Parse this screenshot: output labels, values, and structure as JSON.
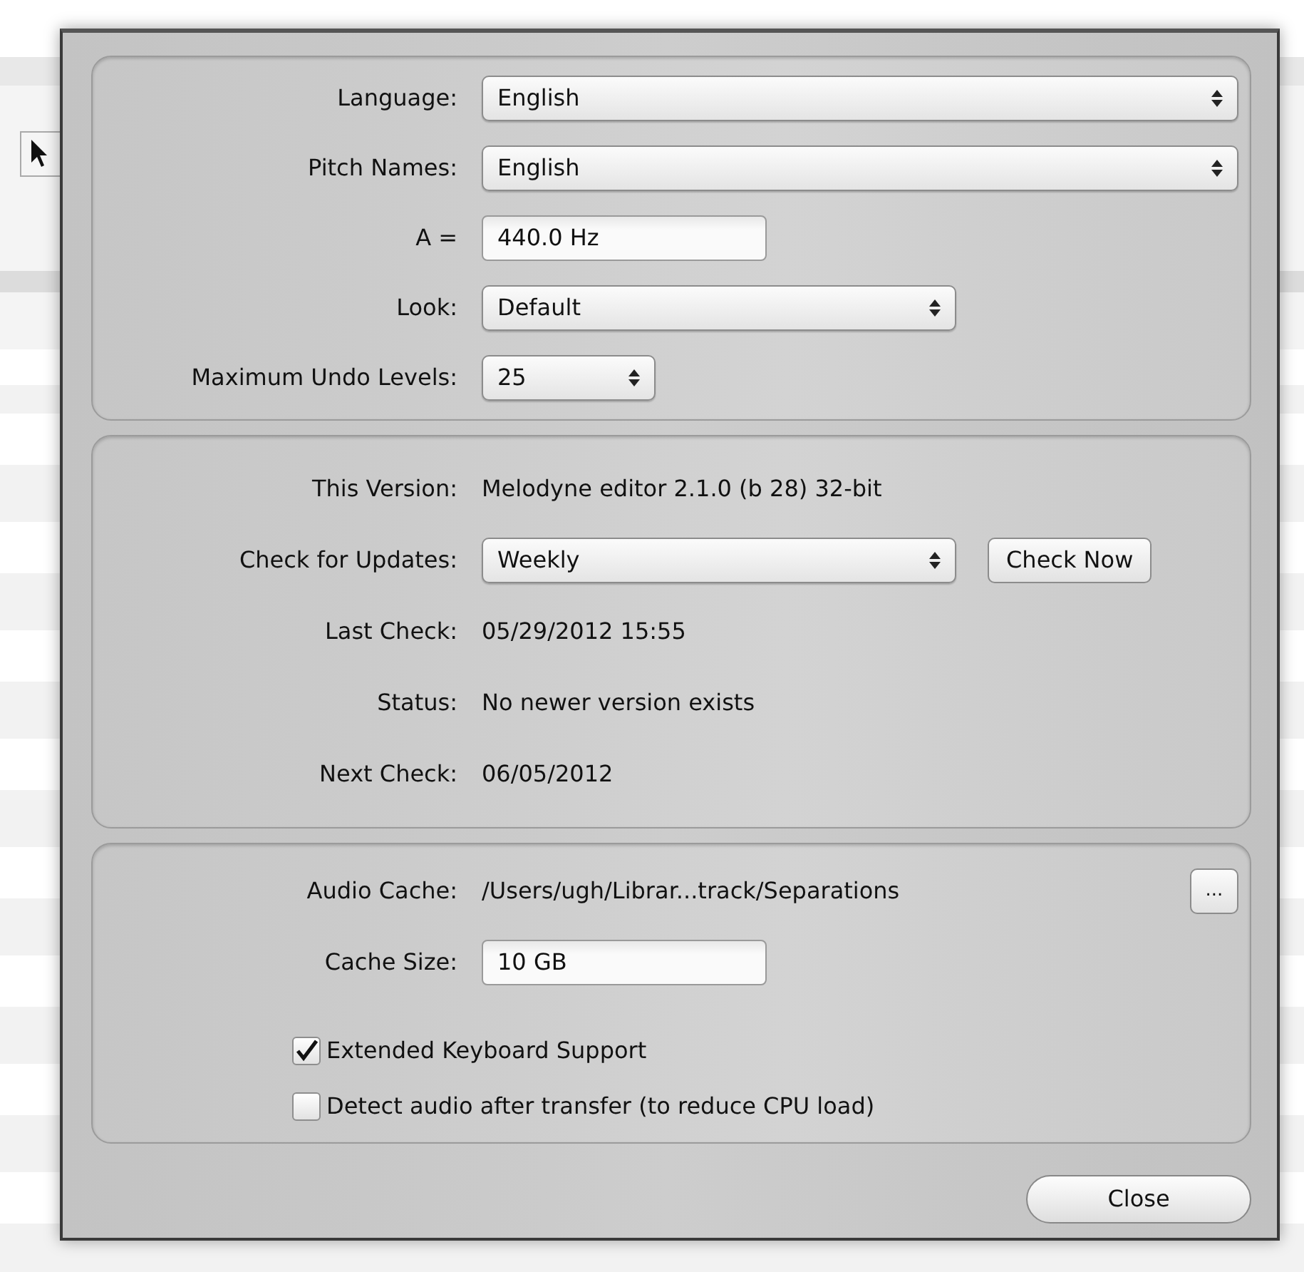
{
  "dialog": {
    "groups": [
      {
        "rows": [
          {
            "label": "Language:",
            "kind": "select",
            "value": "English"
          },
          {
            "label": "Pitch Names:",
            "kind": "select",
            "value": "English"
          },
          {
            "label": "A =",
            "kind": "input",
            "value": "440.0 Hz"
          },
          {
            "label": "Look:",
            "kind": "select",
            "value": "Default"
          },
          {
            "label": "Maximum Undo Levels:",
            "kind": "select",
            "value": "25"
          }
        ]
      },
      {
        "rows": [
          {
            "label": "This Version:",
            "kind": "text",
            "value": "Melodyne editor 2.1.0 (b 28) 32-bit"
          },
          {
            "label": "Check for Updates:",
            "kind": "select",
            "value": "Weekly",
            "button": "Check Now"
          },
          {
            "label": "Last Check:",
            "kind": "text",
            "value": "05/29/2012 15:55"
          },
          {
            "label": "Status:",
            "kind": "text",
            "value": "No newer version exists"
          },
          {
            "label": "Next Check:",
            "kind": "text",
            "value": "06/05/2012"
          }
        ]
      },
      {
        "rows": [
          {
            "label": "Audio Cache:",
            "kind": "text",
            "value": "/Users/ugh/Librar...track/Separations",
            "button": "..."
          },
          {
            "label": "Cache Size:",
            "kind": "input",
            "value": "10 GB"
          },
          {
            "label": "Extended Keyboard Support",
            "kind": "checkbox",
            "checked": true
          },
          {
            "label": "Detect audio after transfer (to reduce CPU load)",
            "kind": "checkbox",
            "checked": false
          }
        ]
      }
    ],
    "close_button": "Close"
  }
}
